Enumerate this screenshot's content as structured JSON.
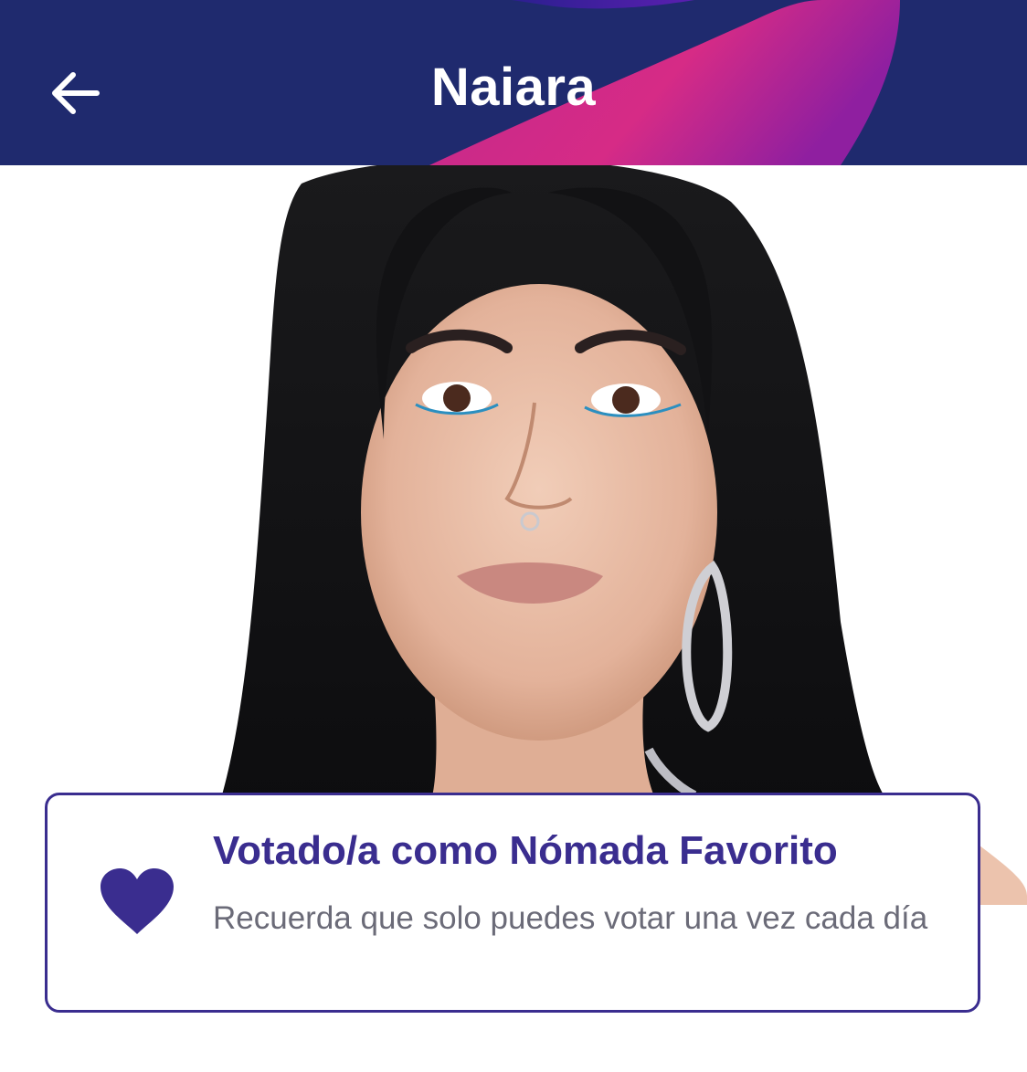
{
  "header": {
    "title": "Naiara",
    "back_icon": "arrow-left-icon",
    "background_color": "#1f2a6e",
    "accent_color": "#d32b8a"
  },
  "vote_card": {
    "icon": "heart-icon",
    "title": "Votado/a como Nómada Favorito",
    "subtitle": "Recuerda que solo puedes votar una vez cada día",
    "accent_color": "#3a2d8f"
  }
}
